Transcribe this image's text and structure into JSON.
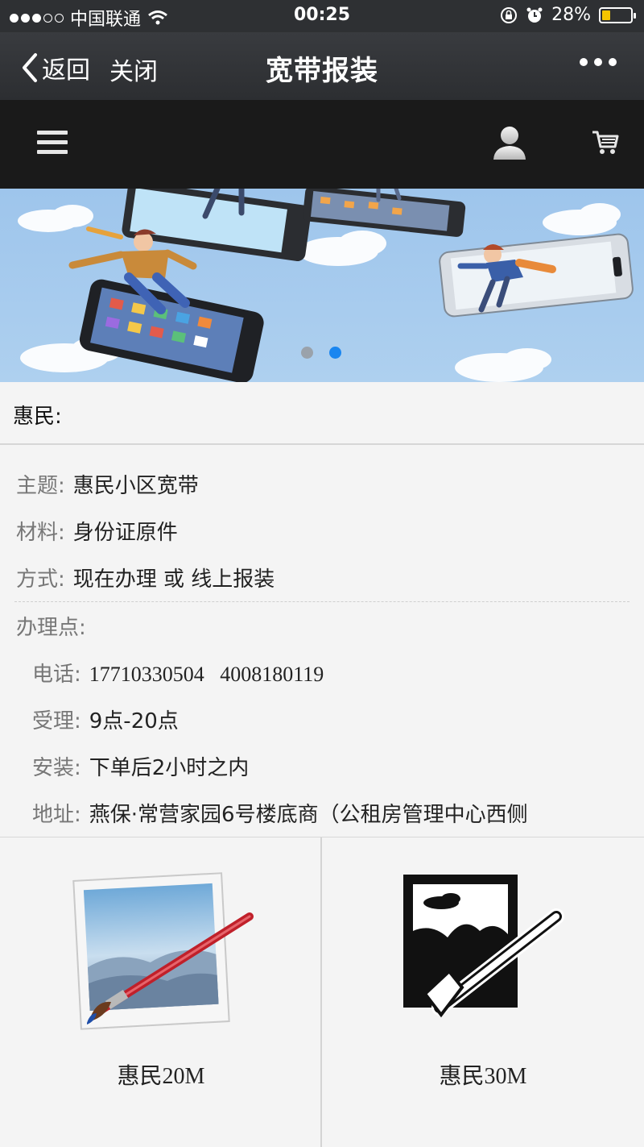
{
  "status_bar": {
    "carrier": "中国联通",
    "time": "00:25",
    "battery_percent": "28%",
    "battery_level": 0.28,
    "signal_bars_filled": 3,
    "signal_bars_total": 5
  },
  "nav": {
    "back_label": "返回",
    "close_label": "关闭",
    "title": "宽带报装"
  },
  "banner": {
    "slide_count": 2,
    "active_slide": 2
  },
  "section_title": "惠民:",
  "info": {
    "topic_label": "主题:",
    "topic_value": "惠民小区宽带",
    "material_label": "材料:",
    "material_value": "身份证原件",
    "method_label": "方式:",
    "method_value": "现在办理 或 线上报装",
    "office_label": "办理点:",
    "phone_label": "电话:",
    "phone_value": "17710330504   4008180119",
    "hours_label": "受理:",
    "hours_value": "9点-20点",
    "install_label": "安装:",
    "install_value": "下单后2小时之内",
    "address_label": "地址:",
    "address_value": "燕保·常营家园6号楼底商（公租房管理中心西侧"
  },
  "products": [
    {
      "name": "惠民20M",
      "icon": "photo-paint-icon"
    },
    {
      "name": "惠民30M",
      "icon": "image-edit-icon"
    }
  ],
  "colors": {
    "status_bar_bg": "#2e3033",
    "nav_bg": "#34363a",
    "header_bg": "#1a1a1a",
    "page_bg": "#f4f4f4",
    "pager_active": "#1a86f0",
    "battery_fill": "#f5c400"
  }
}
